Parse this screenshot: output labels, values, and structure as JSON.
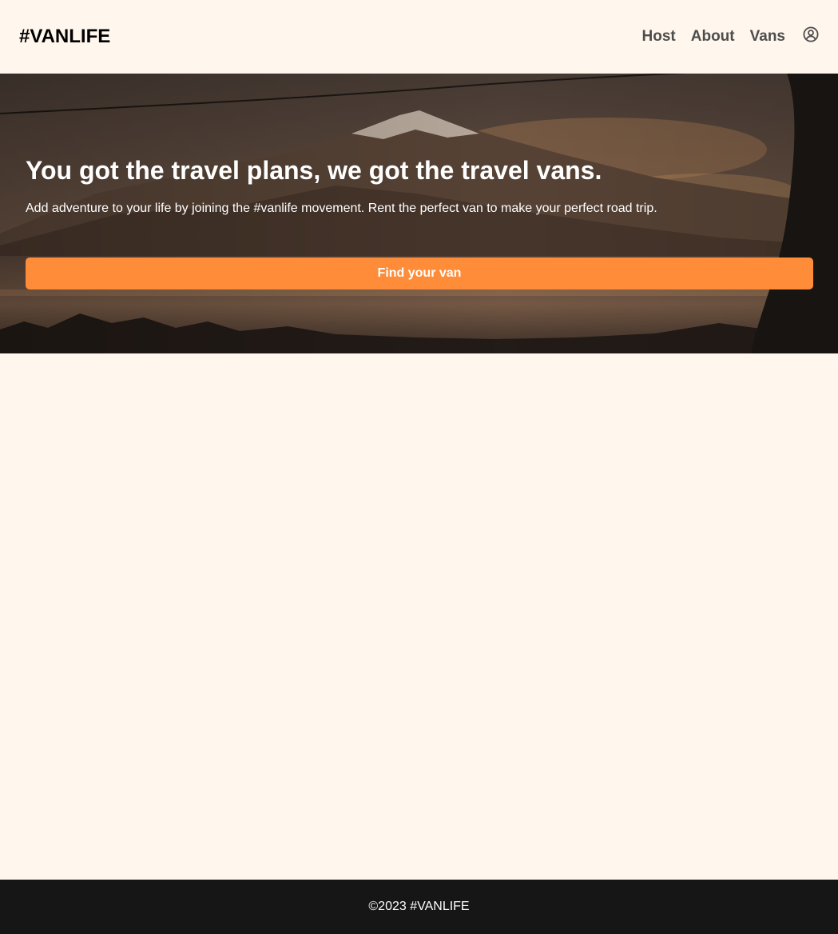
{
  "header": {
    "logo": "#VANLIFE",
    "nav": [
      {
        "label": "Host"
      },
      {
        "label": "About"
      },
      {
        "label": "Vans"
      }
    ],
    "user_icon": "user-circle-icon"
  },
  "hero": {
    "title": "You got the travel plans, we got the travel vans.",
    "subtitle": "Add adventure to your life by joining the #vanlife movement. Rent the perfect van to make your perfect road trip.",
    "button_label": "Find your van",
    "button_color": "#FF8C38"
  },
  "footer": {
    "text": "©2023 #VANLIFE"
  },
  "colors": {
    "page_bg": "#FFF7ED",
    "footer_bg": "#161616",
    "nav_text": "#4D4D4D"
  }
}
